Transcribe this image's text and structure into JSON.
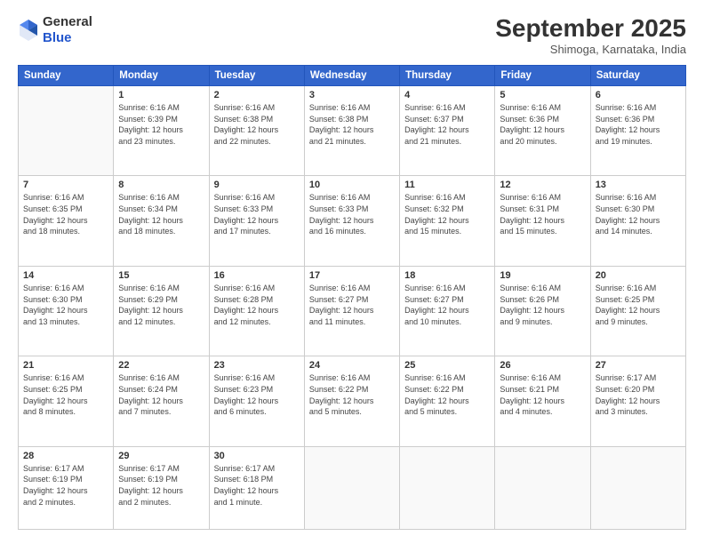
{
  "header": {
    "logo": {
      "general": "General",
      "blue": "Blue"
    },
    "month": "September 2025",
    "location": "Shimoga, Karnataka, India"
  },
  "days_of_week": [
    "Sunday",
    "Monday",
    "Tuesday",
    "Wednesday",
    "Thursday",
    "Friday",
    "Saturday"
  ],
  "weeks": [
    [
      {
        "day": "",
        "info": ""
      },
      {
        "day": "1",
        "info": "Sunrise: 6:16 AM\nSunset: 6:39 PM\nDaylight: 12 hours\nand 23 minutes."
      },
      {
        "day": "2",
        "info": "Sunrise: 6:16 AM\nSunset: 6:38 PM\nDaylight: 12 hours\nand 22 minutes."
      },
      {
        "day": "3",
        "info": "Sunrise: 6:16 AM\nSunset: 6:38 PM\nDaylight: 12 hours\nand 21 minutes."
      },
      {
        "day": "4",
        "info": "Sunrise: 6:16 AM\nSunset: 6:37 PM\nDaylight: 12 hours\nand 21 minutes."
      },
      {
        "day": "5",
        "info": "Sunrise: 6:16 AM\nSunset: 6:36 PM\nDaylight: 12 hours\nand 20 minutes."
      },
      {
        "day": "6",
        "info": "Sunrise: 6:16 AM\nSunset: 6:36 PM\nDaylight: 12 hours\nand 19 minutes."
      }
    ],
    [
      {
        "day": "7",
        "info": "Sunrise: 6:16 AM\nSunset: 6:35 PM\nDaylight: 12 hours\nand 18 minutes."
      },
      {
        "day": "8",
        "info": "Sunrise: 6:16 AM\nSunset: 6:34 PM\nDaylight: 12 hours\nand 18 minutes."
      },
      {
        "day": "9",
        "info": "Sunrise: 6:16 AM\nSunset: 6:33 PM\nDaylight: 12 hours\nand 17 minutes."
      },
      {
        "day": "10",
        "info": "Sunrise: 6:16 AM\nSunset: 6:33 PM\nDaylight: 12 hours\nand 16 minutes."
      },
      {
        "day": "11",
        "info": "Sunrise: 6:16 AM\nSunset: 6:32 PM\nDaylight: 12 hours\nand 15 minutes."
      },
      {
        "day": "12",
        "info": "Sunrise: 6:16 AM\nSunset: 6:31 PM\nDaylight: 12 hours\nand 15 minutes."
      },
      {
        "day": "13",
        "info": "Sunrise: 6:16 AM\nSunset: 6:30 PM\nDaylight: 12 hours\nand 14 minutes."
      }
    ],
    [
      {
        "day": "14",
        "info": "Sunrise: 6:16 AM\nSunset: 6:30 PM\nDaylight: 12 hours\nand 13 minutes."
      },
      {
        "day": "15",
        "info": "Sunrise: 6:16 AM\nSunset: 6:29 PM\nDaylight: 12 hours\nand 12 minutes."
      },
      {
        "day": "16",
        "info": "Sunrise: 6:16 AM\nSunset: 6:28 PM\nDaylight: 12 hours\nand 12 minutes."
      },
      {
        "day": "17",
        "info": "Sunrise: 6:16 AM\nSunset: 6:27 PM\nDaylight: 12 hours\nand 11 minutes."
      },
      {
        "day": "18",
        "info": "Sunrise: 6:16 AM\nSunset: 6:27 PM\nDaylight: 12 hours\nand 10 minutes."
      },
      {
        "day": "19",
        "info": "Sunrise: 6:16 AM\nSunset: 6:26 PM\nDaylight: 12 hours\nand 9 minutes."
      },
      {
        "day": "20",
        "info": "Sunrise: 6:16 AM\nSunset: 6:25 PM\nDaylight: 12 hours\nand 9 minutes."
      }
    ],
    [
      {
        "day": "21",
        "info": "Sunrise: 6:16 AM\nSunset: 6:25 PM\nDaylight: 12 hours\nand 8 minutes."
      },
      {
        "day": "22",
        "info": "Sunrise: 6:16 AM\nSunset: 6:24 PM\nDaylight: 12 hours\nand 7 minutes."
      },
      {
        "day": "23",
        "info": "Sunrise: 6:16 AM\nSunset: 6:23 PM\nDaylight: 12 hours\nand 6 minutes."
      },
      {
        "day": "24",
        "info": "Sunrise: 6:16 AM\nSunset: 6:22 PM\nDaylight: 12 hours\nand 5 minutes."
      },
      {
        "day": "25",
        "info": "Sunrise: 6:16 AM\nSunset: 6:22 PM\nDaylight: 12 hours\nand 5 minutes."
      },
      {
        "day": "26",
        "info": "Sunrise: 6:16 AM\nSunset: 6:21 PM\nDaylight: 12 hours\nand 4 minutes."
      },
      {
        "day": "27",
        "info": "Sunrise: 6:17 AM\nSunset: 6:20 PM\nDaylight: 12 hours\nand 3 minutes."
      }
    ],
    [
      {
        "day": "28",
        "info": "Sunrise: 6:17 AM\nSunset: 6:19 PM\nDaylight: 12 hours\nand 2 minutes."
      },
      {
        "day": "29",
        "info": "Sunrise: 6:17 AM\nSunset: 6:19 PM\nDaylight: 12 hours\nand 2 minutes."
      },
      {
        "day": "30",
        "info": "Sunrise: 6:17 AM\nSunset: 6:18 PM\nDaylight: 12 hours\nand 1 minute."
      },
      {
        "day": "",
        "info": ""
      },
      {
        "day": "",
        "info": ""
      },
      {
        "day": "",
        "info": ""
      },
      {
        "day": "",
        "info": ""
      }
    ]
  ]
}
